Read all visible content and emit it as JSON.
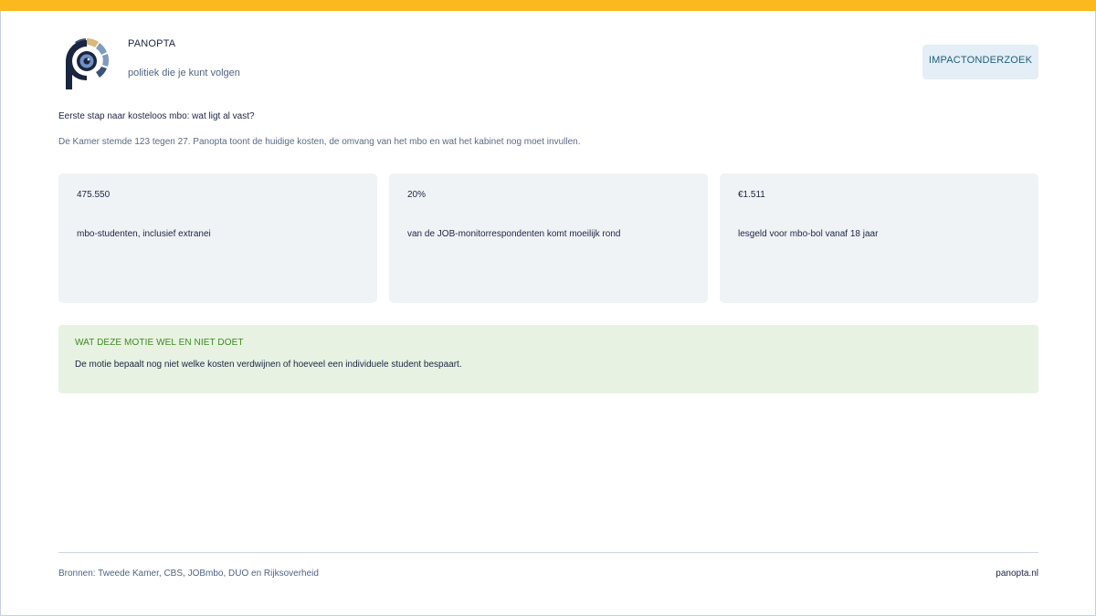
{
  "header": {
    "brand": "PANOPTA",
    "tagline": "politiek die je kunt volgen",
    "button_label": "IMPACTONDERZOEK",
    "logo_icon": "panopta-eye-logo-icon"
  },
  "intro": {
    "headline": "Eerste stap naar kosteloos mbo: wat ligt al vast?",
    "subline": "De Kamer stemde 123 tegen 27. Panopta toont de huidige kosten, de omvang van het mbo en wat het kabinet nog moet invullen."
  },
  "stats": [
    {
      "value": "475.550",
      "label": "mbo-studenten, inclusief extranei"
    },
    {
      "value": "20%",
      "label": "van de JOB-monitorrespondenten komt moeilijk rond"
    },
    {
      "value": "€1.511",
      "label": "lesgeld voor mbo-bol vanaf 18 jaar"
    }
  ],
  "note": {
    "title": "WAT DEZE MOTIE WEL EN NIET DOET",
    "text": "De motie bepaalt nog niet welke kosten verdwijnen of hoeveel een individuele student bespaart."
  },
  "footer": {
    "sources": "Bronnen: Tweede Kamer, CBS, JOBmbo, DUO en Rijksoverheid",
    "site": "panopta.nl"
  },
  "colors": {
    "accent_bar": "#fbb91d",
    "logo_navy": "#1a2540",
    "logo_gold": "#d9b878",
    "logo_blue": "#7f9cc0",
    "note_background": "#e7f2e3",
    "note_title": "#3b8b1e",
    "card_background": "#f0f3f6",
    "button_background": "#e3eef6"
  }
}
